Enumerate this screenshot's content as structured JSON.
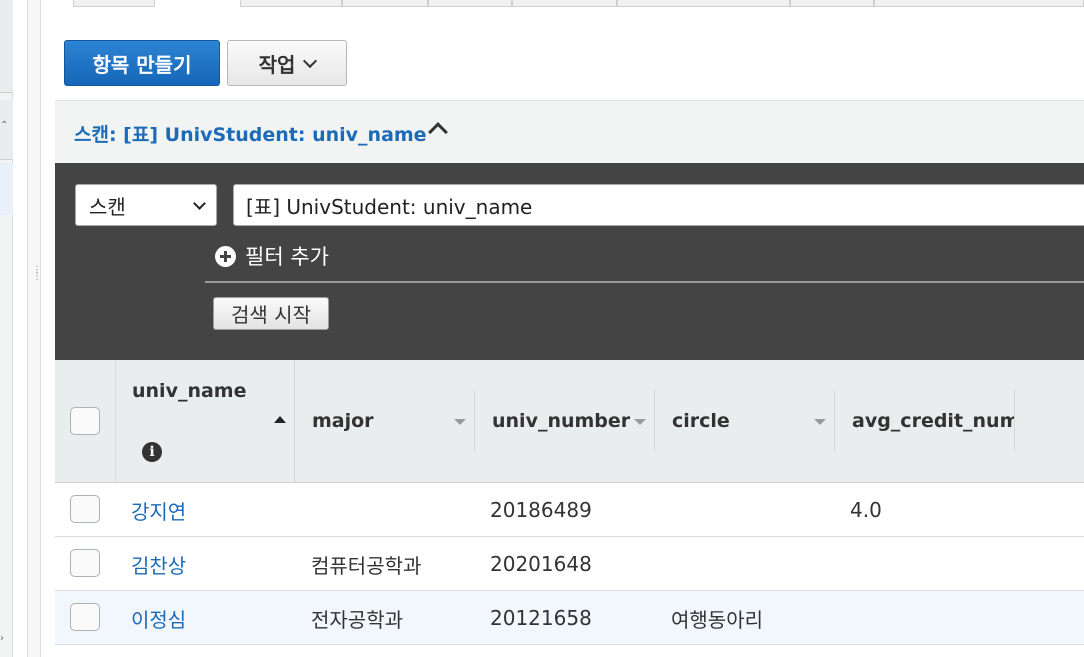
{
  "toolbar": {
    "create_item_label": "항목 만들기",
    "actions_label": "작업"
  },
  "scan": {
    "header_title": "스캔: [표] UnivStudent: univ_name",
    "mode_value": "스캔",
    "target_value": "[표] UnivStudent: univ_name",
    "add_filter_label": "필터 추가",
    "start_search_label": "검색 시작"
  },
  "table": {
    "columns": [
      "univ_name",
      "major",
      "univ_number",
      "circle",
      "avg_credit_num"
    ],
    "rows": [
      {
        "univ_name": "강지연",
        "major": "",
        "univ_number": "20186489",
        "circle": "",
        "avg_credit_num": "4.0",
        "selected": false
      },
      {
        "univ_name": "김찬상",
        "major": "컴퓨터공학과",
        "univ_number": "20201648",
        "circle": "",
        "avg_credit_num": "",
        "selected": false
      },
      {
        "univ_name": "이정심",
        "major": "전자공학과",
        "univ_number": "20121658",
        "circle": "여행동아리",
        "avg_credit_num": "",
        "selected": true
      }
    ]
  },
  "colors": {
    "primary": "#1b6bb8",
    "panel_dark": "#444444",
    "header_bg": "#eaeded"
  }
}
